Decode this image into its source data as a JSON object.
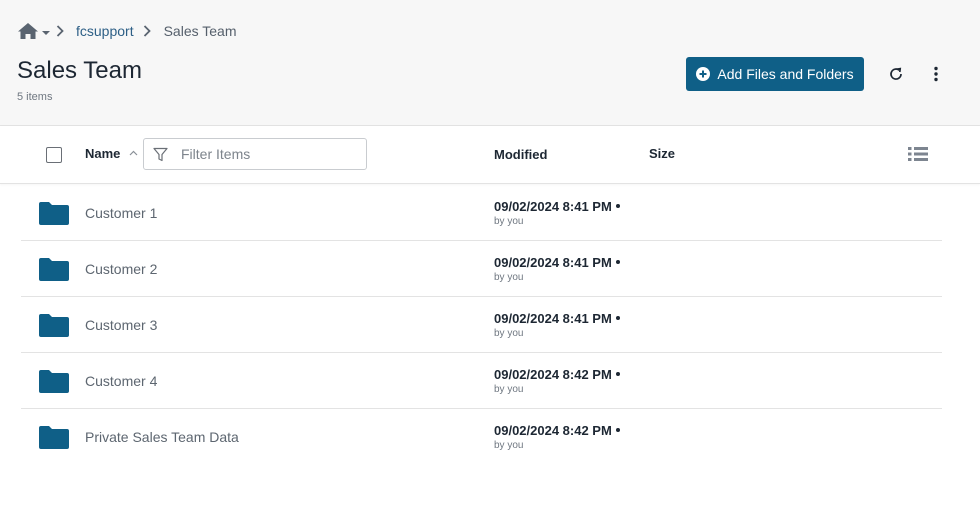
{
  "breadcrumb": {
    "home_icon": "home-icon",
    "items": [
      "fcsupport",
      "Sales Team"
    ]
  },
  "page": {
    "title": "Sales Team",
    "item_count": "5 items"
  },
  "toolbar": {
    "add_label": "Add Files and Folders",
    "refresh_icon": "refresh-icon",
    "more_icon": "more-vertical-icon"
  },
  "columns": {
    "name": "Name",
    "modified": "Modified",
    "size": "Size"
  },
  "filter": {
    "placeholder": "Filter Items",
    "value": ""
  },
  "rows": [
    {
      "name": "Customer 1",
      "modified": "09/02/2024 8:41 PM",
      "by": "by you",
      "size": ""
    },
    {
      "name": "Customer 2",
      "modified": "09/02/2024 8:41 PM",
      "by": "by you",
      "size": ""
    },
    {
      "name": "Customer 3",
      "modified": "09/02/2024 8:41 PM",
      "by": "by you",
      "size": ""
    },
    {
      "name": "Customer 4",
      "modified": "09/02/2024 8:42 PM",
      "by": "by you",
      "size": ""
    },
    {
      "name": "Private Sales Team Data",
      "modified": "09/02/2024 8:42 PM",
      "by": "by you",
      "size": ""
    }
  ],
  "colors": {
    "accent": "#0f5f87",
    "folder": "#0f5f87",
    "link": "#2d5f86"
  }
}
